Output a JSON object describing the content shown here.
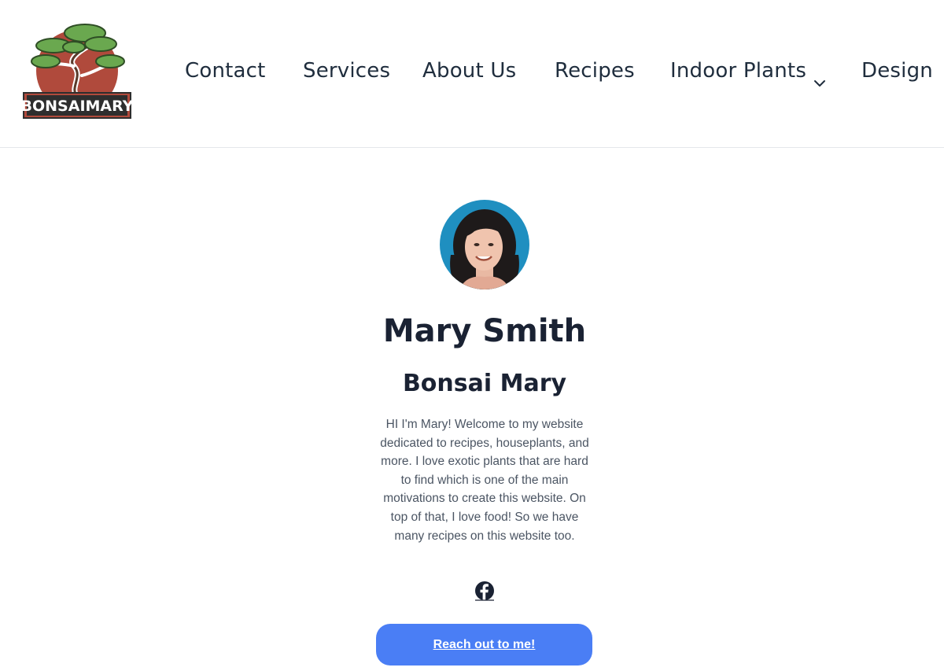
{
  "header": {
    "logo_text": "BONSAIMARY",
    "nav": [
      {
        "label": "Contact"
      },
      {
        "label": "Services"
      },
      {
        "label": "About Us"
      },
      {
        "label": "Recipes"
      },
      {
        "label": "Indoor Plants",
        "icon": "chevron-down-icon"
      },
      {
        "label": "Design"
      }
    ]
  },
  "profile": {
    "name": "Mary Smith",
    "subtitle": "Bonsai Mary",
    "bio": "HI I'm Mary! Welcome to my website dedicated to recipes, houseplants, and more. I love exotic plants that are hard to find which is one of the main motivations to create this website. On top of that, I love food! So we have many recipes on this website too.",
    "social_icon": "facebook-icon",
    "cta_label": "Reach out to me!"
  },
  "colors": {
    "cta_background": "#4a7ef5",
    "avatar_background": "#1f8fc0",
    "logo_red": "#b04a3c",
    "logo_green": "#6aa84f"
  }
}
